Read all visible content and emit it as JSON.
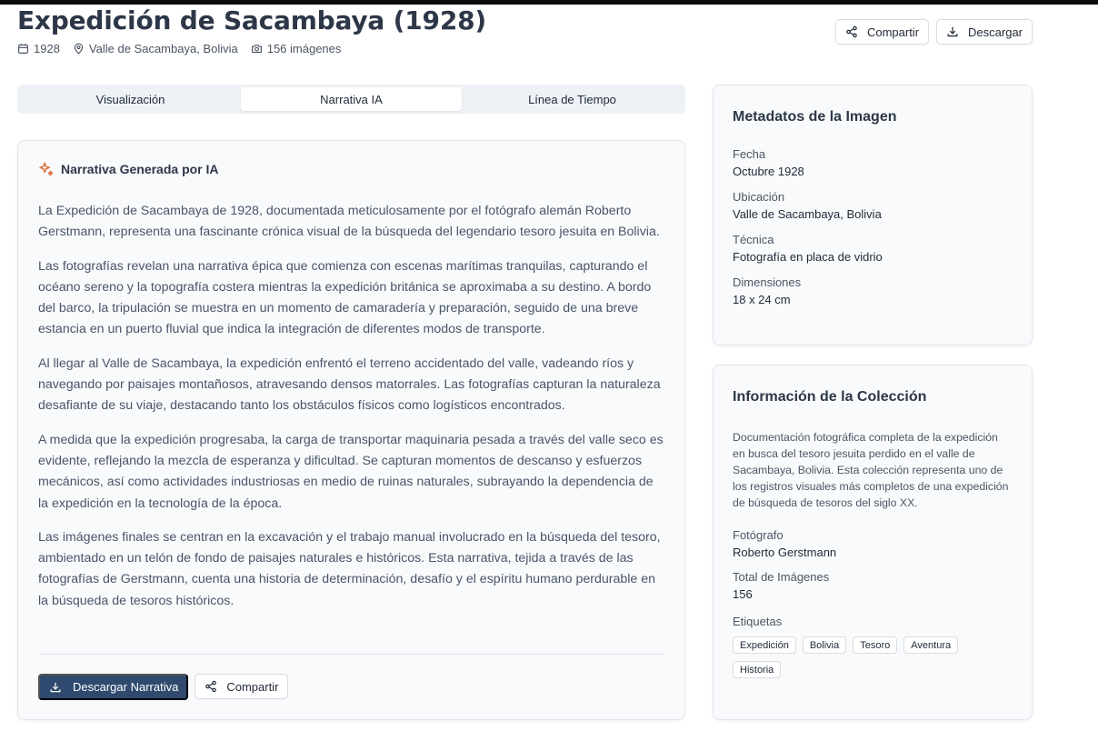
{
  "header": {
    "title": "Expedición de Sacambaya (1928)",
    "year": "1928",
    "location": "Valle de Sacambaya, Bolivia",
    "image_count": "156 imágenes",
    "share_label": "Compartir",
    "download_label": "Descargar"
  },
  "tabs": [
    {
      "label": "Visualización"
    },
    {
      "label": "Narrativa IA"
    },
    {
      "label": "Línea de Tiempo"
    }
  ],
  "narrative": {
    "heading": "Narrativa Generada por IA",
    "paragraphs": [
      "La Expedición de Sacambaya de 1928, documentada meticulosamente por el fotógrafo alemán Roberto Gerstmann, representa una fascinante crónica visual de la búsqueda del legendario tesoro jesuita en Bolivia.",
      "Las fotografías revelan una narrativa épica que comienza con escenas marítimas tranquilas, capturando el océano sereno y la topografía costera mientras la expedición británica se aproximaba a su destino. A bordo del barco, la tripulación se muestra en un momento de camaradería y preparación, seguido de una breve estancia en un puerto fluvial que indica la integración de diferentes modos de transporte.",
      "Al llegar al Valle de Sacambaya, la expedición enfrentó el terreno accidentado del valle, vadeando ríos y navegando por paisajes montañosos, atravesando densos matorrales. Las fotografías capturan la naturaleza desafiante de su viaje, destacando tanto los obstáculos físicos como logísticos encontrados.",
      "A medida que la expedición progresaba, la carga de transportar maquinaria pesada a través del valle seco es evidente, reflejando la mezcla de esperanza y dificultad. Se capturan momentos de descanso y esfuerzos mecánicos, así como actividades industriosas en medio de ruinas naturales, subrayando la dependencia de la expedición en la tecnología de la época.",
      "Las imágenes finales se centran en la excavación y el trabajo manual involucrado en la búsqueda del tesoro, ambientado en un telón de fondo de paisajes naturales e históricos. Esta narrativa, tejida a través de las fotografías de Gerstmann, cuenta una historia de determinación, desafío y el espíritu humano perdurable en la búsqueda de tesoros históricos."
    ],
    "download_label": "Descargar Narrativa",
    "share_label": "Compartir"
  },
  "image_metadata": {
    "title": "Metadatos de la Imagen",
    "date_label": "Fecha",
    "date_value": "Octubre 1928",
    "location_label": "Ubicación",
    "location_value": "Valle de Sacambaya, Bolivia",
    "technique_label": "Técnica",
    "technique_value": "Fotografía en placa de vidrio",
    "dimensions_label": "Dimensiones",
    "dimensions_value": "18 x 24 cm"
  },
  "collection": {
    "title": "Información de la Colección",
    "description": "Documentación fotográfica completa de la expedición en busca del tesoro jesuita perdido en el valle de Sacambaya, Bolivia. Esta colección representa uno de los registros visuales más completos de una expedición de búsqueda de tesoros del siglo XX.",
    "photographer_label": "Fotógrafo",
    "photographer_value": "Roberto Gerstmann",
    "total_label": "Total de Imágenes",
    "total_value": "156",
    "tags_label": "Etiquetas",
    "tags": [
      "Expedición",
      "Bolivia",
      "Tesoro",
      "Aventura",
      "Historia"
    ]
  },
  "colors": {
    "primary_button": "#2f4a6e",
    "ai_icon": "#e0652b",
    "title": "#2d3748"
  },
  "icons": {
    "calendar": "calendar-icon",
    "location": "map-pin-icon",
    "camera": "camera-icon",
    "share": "share-icon",
    "download": "download-icon",
    "sparkle": "sparkle-icon"
  }
}
